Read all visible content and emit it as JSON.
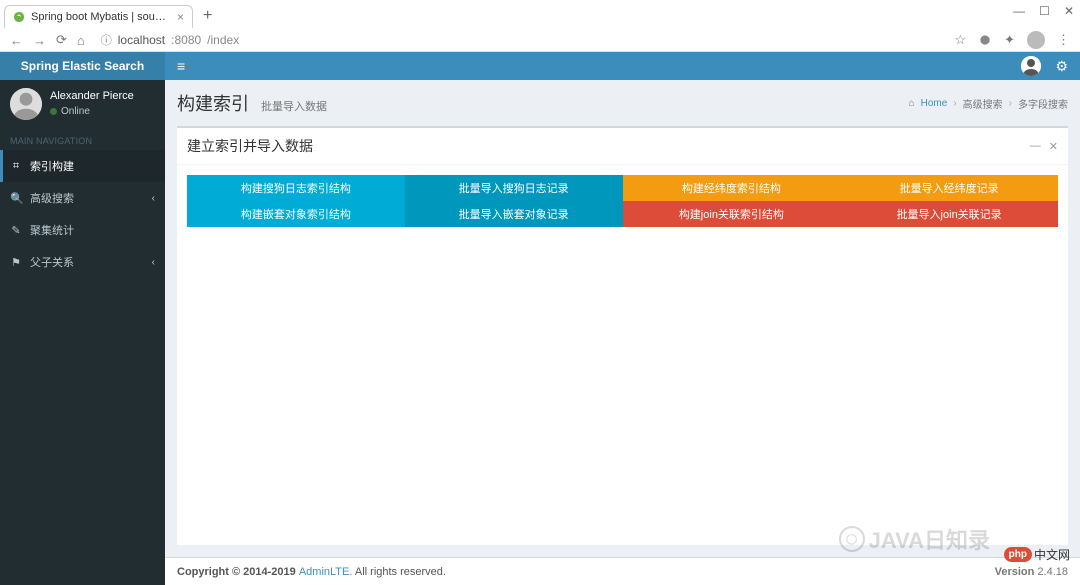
{
  "browser": {
    "tab_title": "Spring boot Mybatis | sougou...",
    "url_host": "localhost",
    "url_port": ":8080",
    "url_path": "/index",
    "win_min": "—",
    "win_max": "☐",
    "win_close": "✕"
  },
  "brand": "Spring Elastic Search",
  "user": {
    "name": "Alexander Pierce",
    "status": "Online"
  },
  "nav_header": "MAIN NAVIGATION",
  "nav": [
    {
      "icon": "⌗",
      "label": "索引构建",
      "active": true,
      "expandable": false
    },
    {
      "icon": "🔍",
      "label": "高级搜索",
      "active": false,
      "expandable": true
    },
    {
      "icon": "✎",
      "label": "聚集统计",
      "active": false,
      "expandable": false
    },
    {
      "icon": "⚑",
      "label": "父子关系",
      "active": false,
      "expandable": true
    }
  ],
  "page": {
    "title": "构建索引",
    "subtitle": "批量导入数据"
  },
  "breadcrumb": {
    "home_icon": "⌂",
    "home": "Home",
    "l1": "高级搜索",
    "l2": "多字段搜索"
  },
  "box": {
    "title": "建立索引并导入数据",
    "minimize": "—",
    "close": "✕"
  },
  "buttons_row1": [
    {
      "label": "构建搜狗日志索引结构",
      "color": "blue"
    },
    {
      "label": "批量导入搜狗日志记录",
      "color": "blue-solid"
    },
    {
      "label": "构建经纬度索引结构",
      "color": "orange"
    },
    {
      "label": "批量导入经纬度记录",
      "color": "orange"
    }
  ],
  "buttons_row2": [
    {
      "label": "构建嵌套对象索引结构",
      "color": "blue"
    },
    {
      "label": "批量导入嵌套对象记录",
      "color": "blue-solid"
    },
    {
      "label": "构建join关联索引结构",
      "color": "red"
    },
    {
      "label": "批量导入join关联记录",
      "color": "red"
    }
  ],
  "footer": {
    "copyright_prefix": "Copyright © 2014-2019 ",
    "brand": "AdminLTE.",
    "suffix": " All rights reserved.",
    "version_label": "Version",
    "version": " 2.4.18"
  },
  "watermark": {
    "text": "JAVA日知录",
    "php": "php",
    "cn": "中文网",
    "version": "Version 2.4.18"
  }
}
